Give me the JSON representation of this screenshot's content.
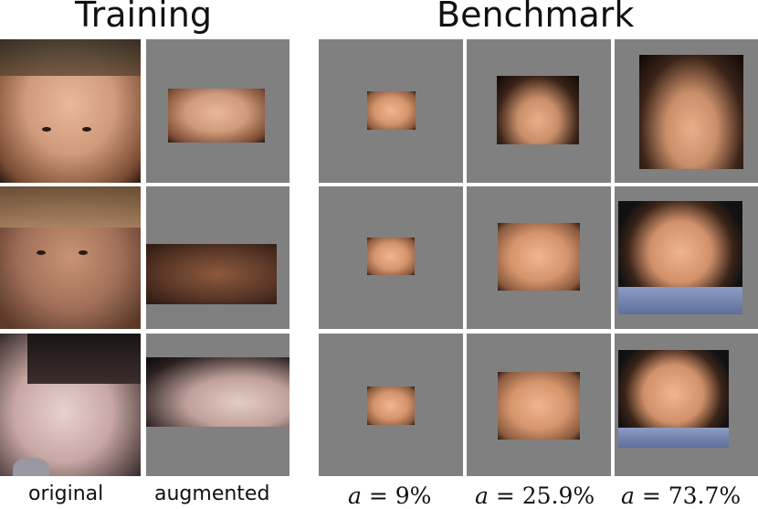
{
  "headers": {
    "training": "Training",
    "benchmark": "Benchmark"
  },
  "captions": {
    "original": "original",
    "augmented": "augmented"
  },
  "benchmark_labels": [
    {
      "var": "a",
      "op": " = ",
      "value": "9",
      "unit": "%"
    },
    {
      "var": "a",
      "op": " = ",
      "value": "25.9",
      "unit": "%"
    },
    {
      "var": "a",
      "op": " = ",
      "value": "73.7",
      "unit": "%"
    }
  ]
}
